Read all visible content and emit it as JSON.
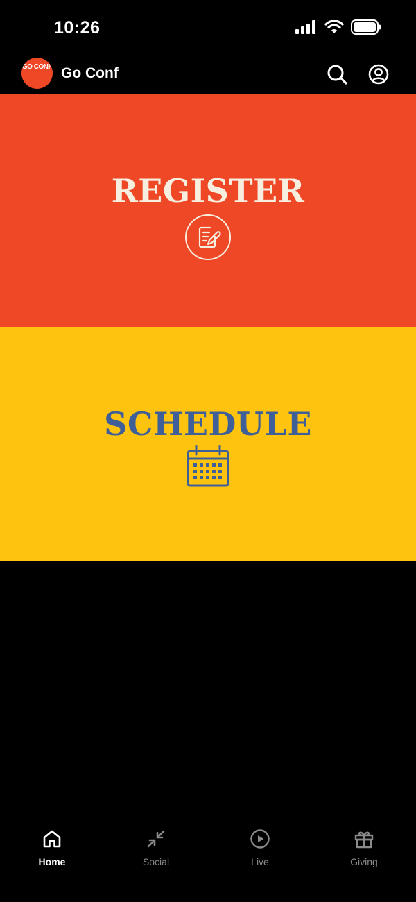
{
  "status_bar": {
    "time": "10:26"
  },
  "header": {
    "logo_text": "GO CONF",
    "title": "Go Conf"
  },
  "tiles": [
    {
      "label": "REGISTER",
      "icon": "edit-note-icon",
      "color": "#EE4827",
      "text_color": "#F6EEDF"
    },
    {
      "label": "SCHEDULE",
      "icon": "calendar-icon",
      "color": "#FEC30E",
      "text_color": "#3F5F98"
    }
  ],
  "tab_bar": {
    "items": [
      {
        "label": "Home",
        "icon": "home-icon",
        "active": true
      },
      {
        "label": "Social",
        "icon": "social-icon",
        "active": false
      },
      {
        "label": "Live",
        "icon": "play-icon",
        "active": false
      },
      {
        "label": "Giving",
        "icon": "gift-icon",
        "active": false
      }
    ]
  },
  "colors": {
    "background": "#000000",
    "accent": "#EE4827",
    "inactive_tab": "#8A8A8A"
  }
}
